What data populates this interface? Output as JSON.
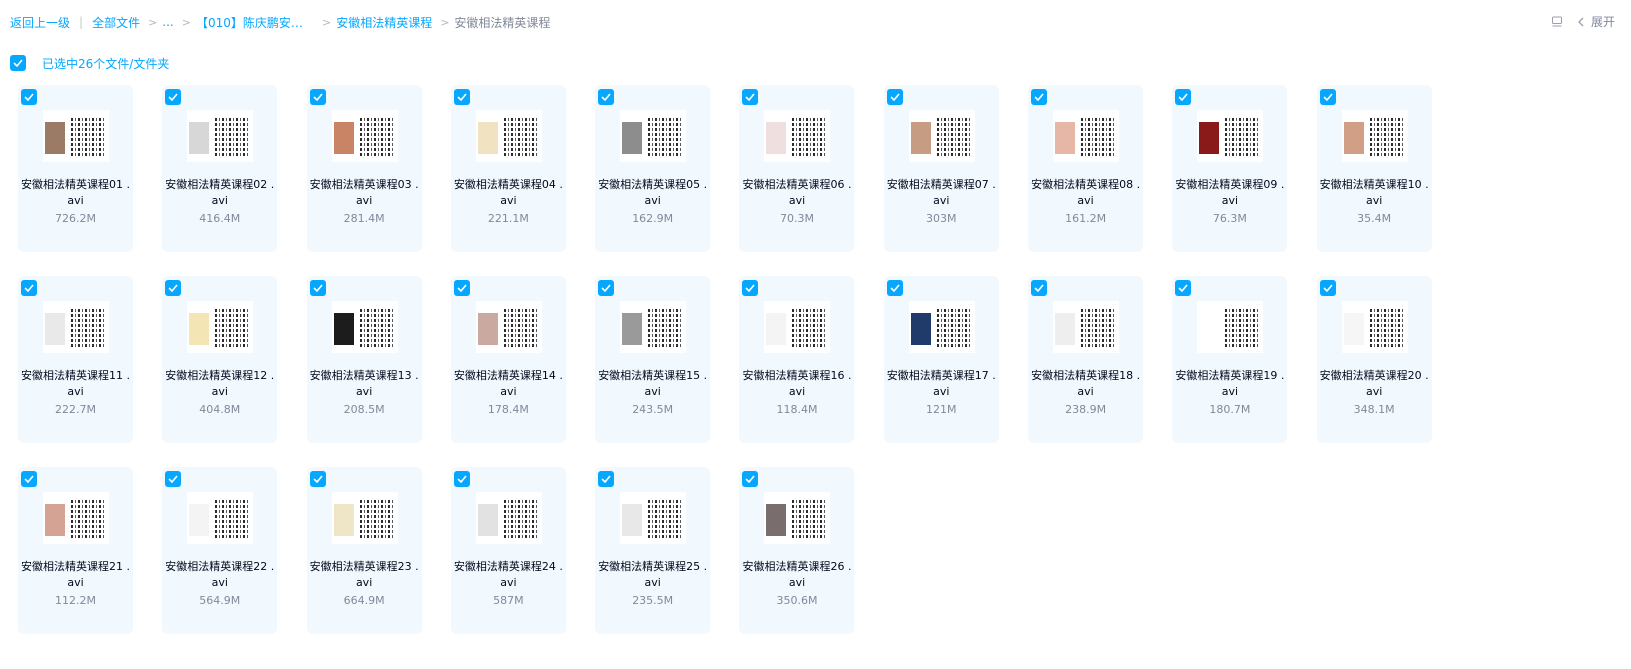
{
  "breadcrumb": {
    "back": "返回上一级",
    "all_files": "全部文件",
    "ellipsis": "...",
    "folder1": "【010】陈庆鹏安徽...",
    "folder2": "安徽相法精英课程",
    "current": "安徽相法精英课程"
  },
  "top_right": {
    "expand_label": "展开",
    "icons": [
      "list-view-icon",
      "chevron-left-icon"
    ]
  },
  "selection": {
    "checked": true,
    "label": "已选中26个文件/文件夹"
  },
  "colors": {
    "accent": "#06a7ff",
    "card_bg": "#f1f9ff",
    "muted": "#818999",
    "text": "#03081a"
  },
  "files": [
    {
      "name": "安徽相法精英课程01 .avi",
      "size": "726.2M",
      "checked": true,
      "thumb_color": "#9b7a66"
    },
    {
      "name": "安徽相法精英课程02 .avi",
      "size": "416.4M",
      "checked": true,
      "thumb_color": "#d7d7d7"
    },
    {
      "name": "安徽相法精英课程03 .avi",
      "size": "281.4M",
      "checked": true,
      "thumb_color": "#c98466"
    },
    {
      "name": "安徽相法精英课程04 .avi",
      "size": "221.1M",
      "checked": true,
      "thumb_color": "#f1e2c2"
    },
    {
      "name": "安徽相法精英课程05 .avi",
      "size": "162.9M",
      "checked": true,
      "thumb_color": "#8d8d8d"
    },
    {
      "name": "安徽相法精英课程06 .avi",
      "size": "70.3M",
      "checked": true,
      "thumb_color": "#efdfdf"
    },
    {
      "name": "安徽相法精英课程07 .avi",
      "size": "303M",
      "checked": true,
      "thumb_color": "#c69c83"
    },
    {
      "name": "安徽相法精英课程08 .avi",
      "size": "161.2M",
      "checked": true,
      "thumb_color": "#e6b6a6"
    },
    {
      "name": "安徽相法精英课程09 .avi",
      "size": "76.3M",
      "checked": true,
      "thumb_color": "#8a1a1a"
    },
    {
      "name": "安徽相法精英课程10 .avi",
      "size": "35.4M",
      "checked": true,
      "thumb_color": "#d19e86"
    },
    {
      "name": "安徽相法精英课程11 .avi",
      "size": "222.7M",
      "checked": true,
      "thumb_color": "#e9e9e9"
    },
    {
      "name": "安徽相法精英课程12 .avi",
      "size": "404.8M",
      "checked": true,
      "thumb_color": "#f3e6b4"
    },
    {
      "name": "安徽相法精英课程13 .avi",
      "size": "208.5M",
      "checked": true,
      "thumb_color": "#1c1c1c"
    },
    {
      "name": "安徽相法精英课程14 .avi",
      "size": "178.4M",
      "checked": true,
      "thumb_color": "#caa9a0"
    },
    {
      "name": "安徽相法精英课程15 .avi",
      "size": "243.5M",
      "checked": true,
      "thumb_color": "#9a9a9a"
    },
    {
      "name": "安徽相法精英课程16 .avi",
      "size": "118.4M",
      "checked": true,
      "thumb_color": "#f4f4f4"
    },
    {
      "name": "安徽相法精英课程17 .avi",
      "size": "121M",
      "checked": true,
      "thumb_color": "#203a6a"
    },
    {
      "name": "安徽相法精英课程18 .avi",
      "size": "238.9M",
      "checked": true,
      "thumb_color": "#eeeeee"
    },
    {
      "name": "安徽相法精英课程19 .avi",
      "size": "180.7M",
      "checked": true,
      "thumb_color": "#ffffff"
    },
    {
      "name": "安徽相法精英课程20 .avi",
      "size": "348.1M",
      "checked": true,
      "thumb_color": "#f6f6f6"
    },
    {
      "name": "安徽相法精英课程21 .avi",
      "size": "112.2M",
      "checked": true,
      "thumb_color": "#d4a394"
    },
    {
      "name": "安徽相法精英课程22 .avi",
      "size": "564.9M",
      "checked": true,
      "thumb_color": "#f4f4f4"
    },
    {
      "name": "安徽相法精英课程23 .avi",
      "size": "664.9M",
      "checked": true,
      "thumb_color": "#efe6c8"
    },
    {
      "name": "安徽相法精英课程24 .avi",
      "size": "587M",
      "checked": true,
      "thumb_color": "#e2e2e2"
    },
    {
      "name": "安徽相法精英课程25 .avi",
      "size": "235.5M",
      "checked": true,
      "thumb_color": "#e8e8e8"
    },
    {
      "name": "安徽相法精英课程26 .avi",
      "size": "350.6M",
      "checked": true,
      "thumb_color": "#7a6d6d"
    }
  ]
}
